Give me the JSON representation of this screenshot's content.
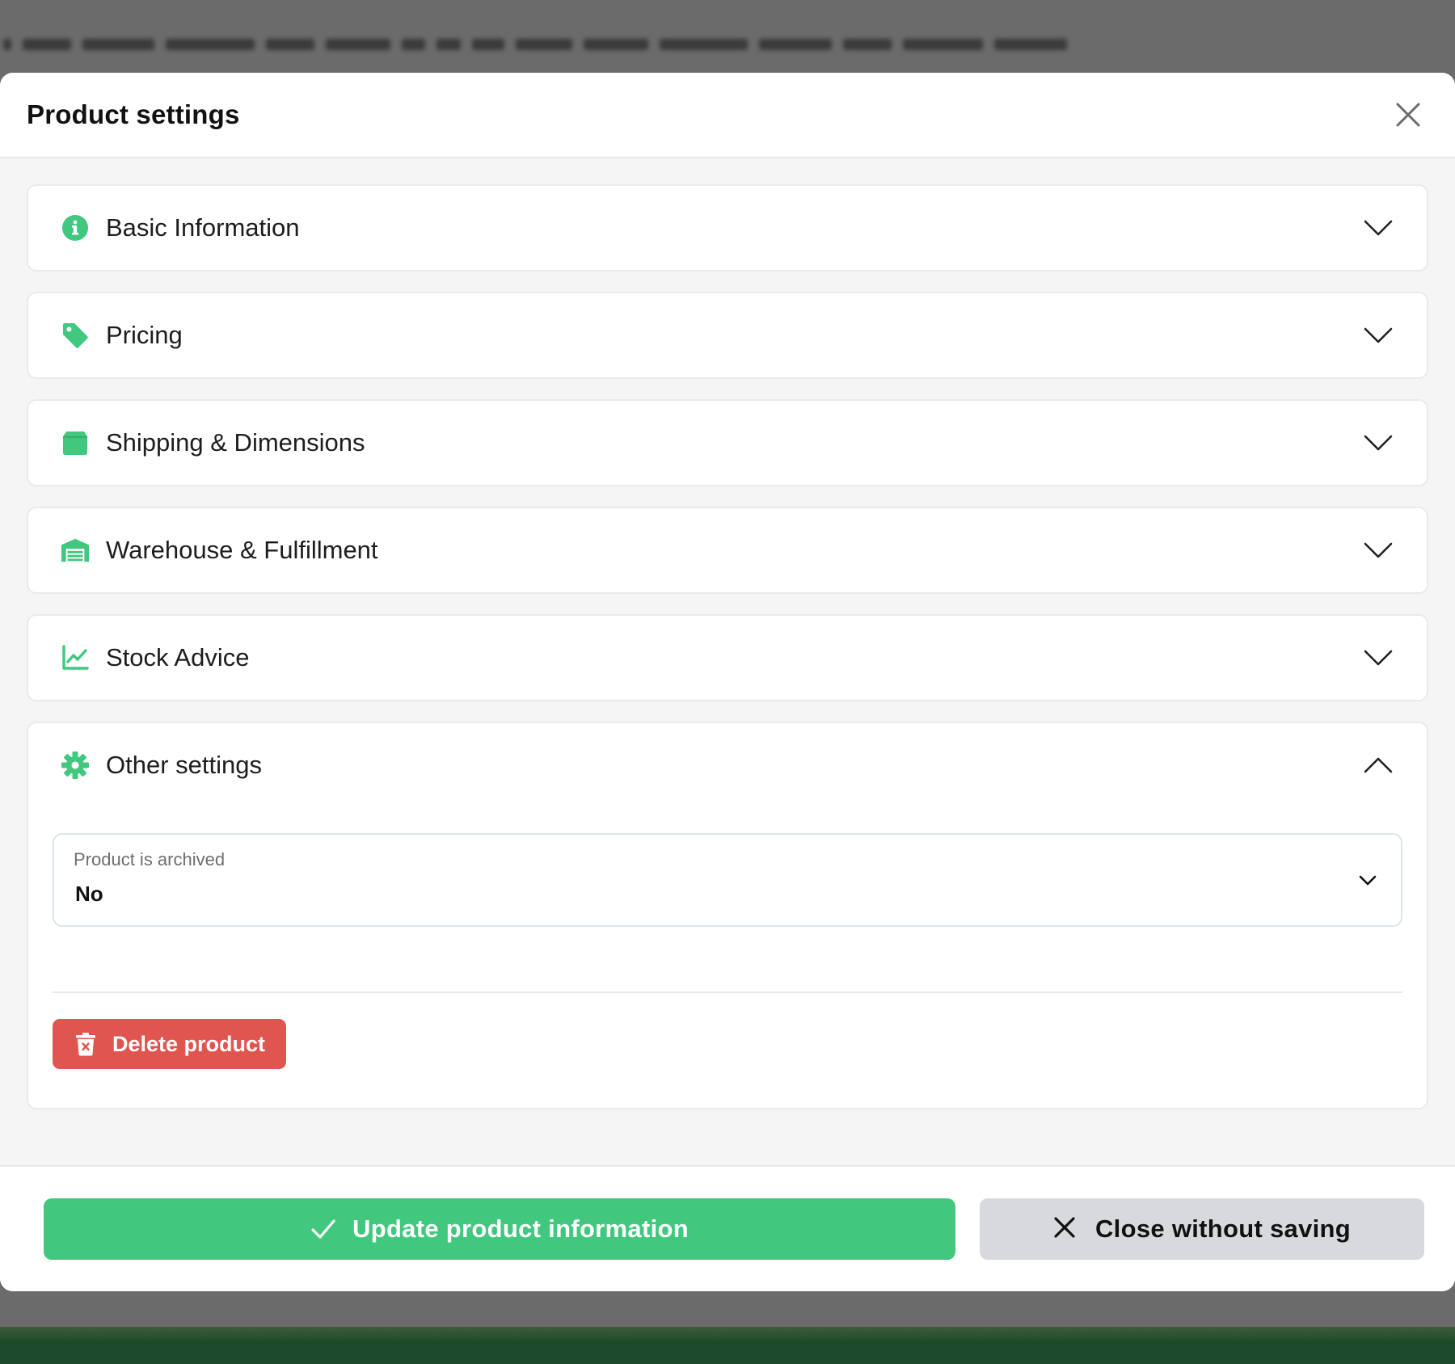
{
  "modal": {
    "title": "Product settings"
  },
  "sections": [
    {
      "label": "Basic Information",
      "icon": "info-circle-icon",
      "expanded": false
    },
    {
      "label": "Pricing",
      "icon": "price-tag-icon",
      "expanded": false
    },
    {
      "label": "Shipping & Dimensions",
      "icon": "box-icon",
      "expanded": false
    },
    {
      "label": "Warehouse & Fulfillment",
      "icon": "warehouse-icon",
      "expanded": false
    },
    {
      "label": "Stock Advice",
      "icon": "line-chart-icon",
      "expanded": false
    },
    {
      "label": "Other settings",
      "icon": "gear-icon",
      "expanded": true
    }
  ],
  "other_settings": {
    "archived_field": {
      "label": "Product is archived",
      "value": "No"
    },
    "delete_label": "Delete product"
  },
  "footer": {
    "update_label": "Update product information",
    "close_label": "Close without saving"
  },
  "colors": {
    "accent_green": "#41c77e",
    "danger_red": "#e0554f",
    "secondary_gray": "#d7d9dd"
  }
}
